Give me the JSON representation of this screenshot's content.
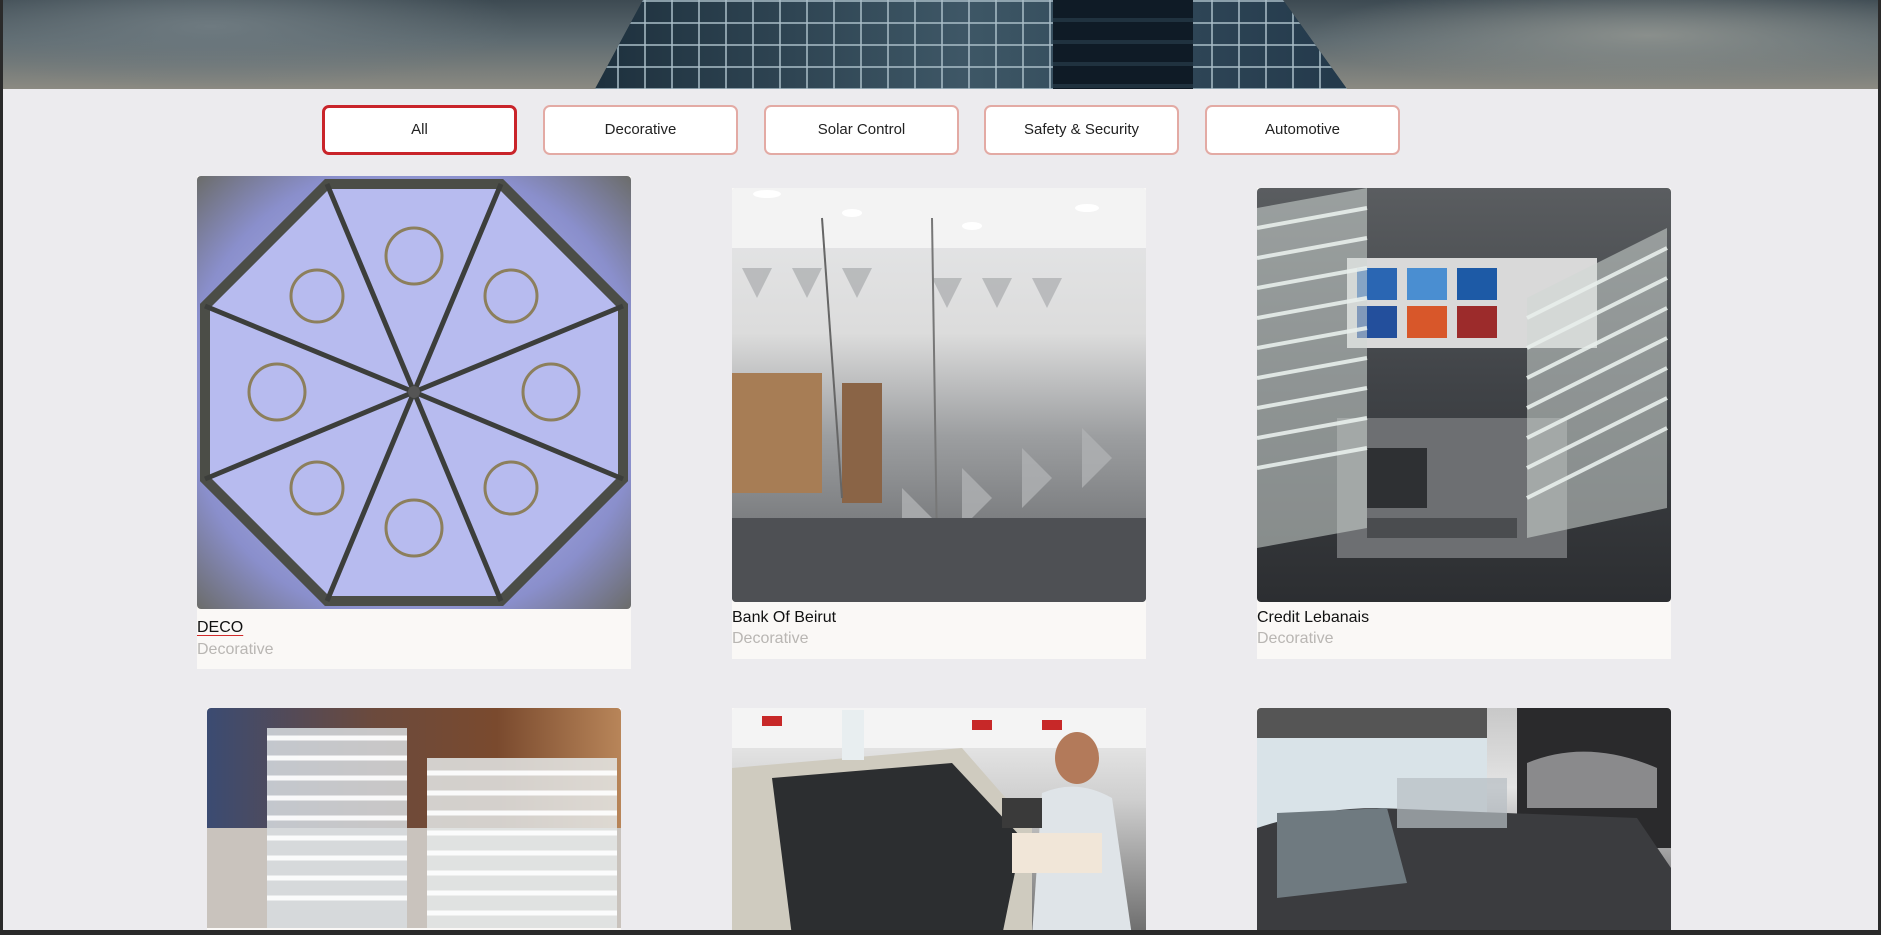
{
  "filters": {
    "all": "All",
    "decorative": "Decorative",
    "solar_control": "Solar Control",
    "safety_security": "Safety & Security",
    "automotive": "Automotive",
    "active": "All"
  },
  "projects": [
    {
      "title": "DECO",
      "category": "Decorative",
      "image": "decorative-glass-dome"
    },
    {
      "title": "Bank Of Beirut",
      "category": "Decorative",
      "image": "frosted-office-partition"
    },
    {
      "title": "Credit Lebanais",
      "category": "Decorative",
      "image": "atm-glass-film"
    },
    {
      "title": "",
      "category": "",
      "image": "striped-frosted-partitions"
    },
    {
      "title": "",
      "category": "",
      "image": "car-window-tint-install"
    },
    {
      "title": "",
      "category": "",
      "image": "car-showroom-tint"
    }
  ],
  "colors": {
    "active_border": "#c9242a",
    "button_border": "#e3aaa4",
    "category_text": "#b9b6b3",
    "page_bg": "#ecebee"
  }
}
